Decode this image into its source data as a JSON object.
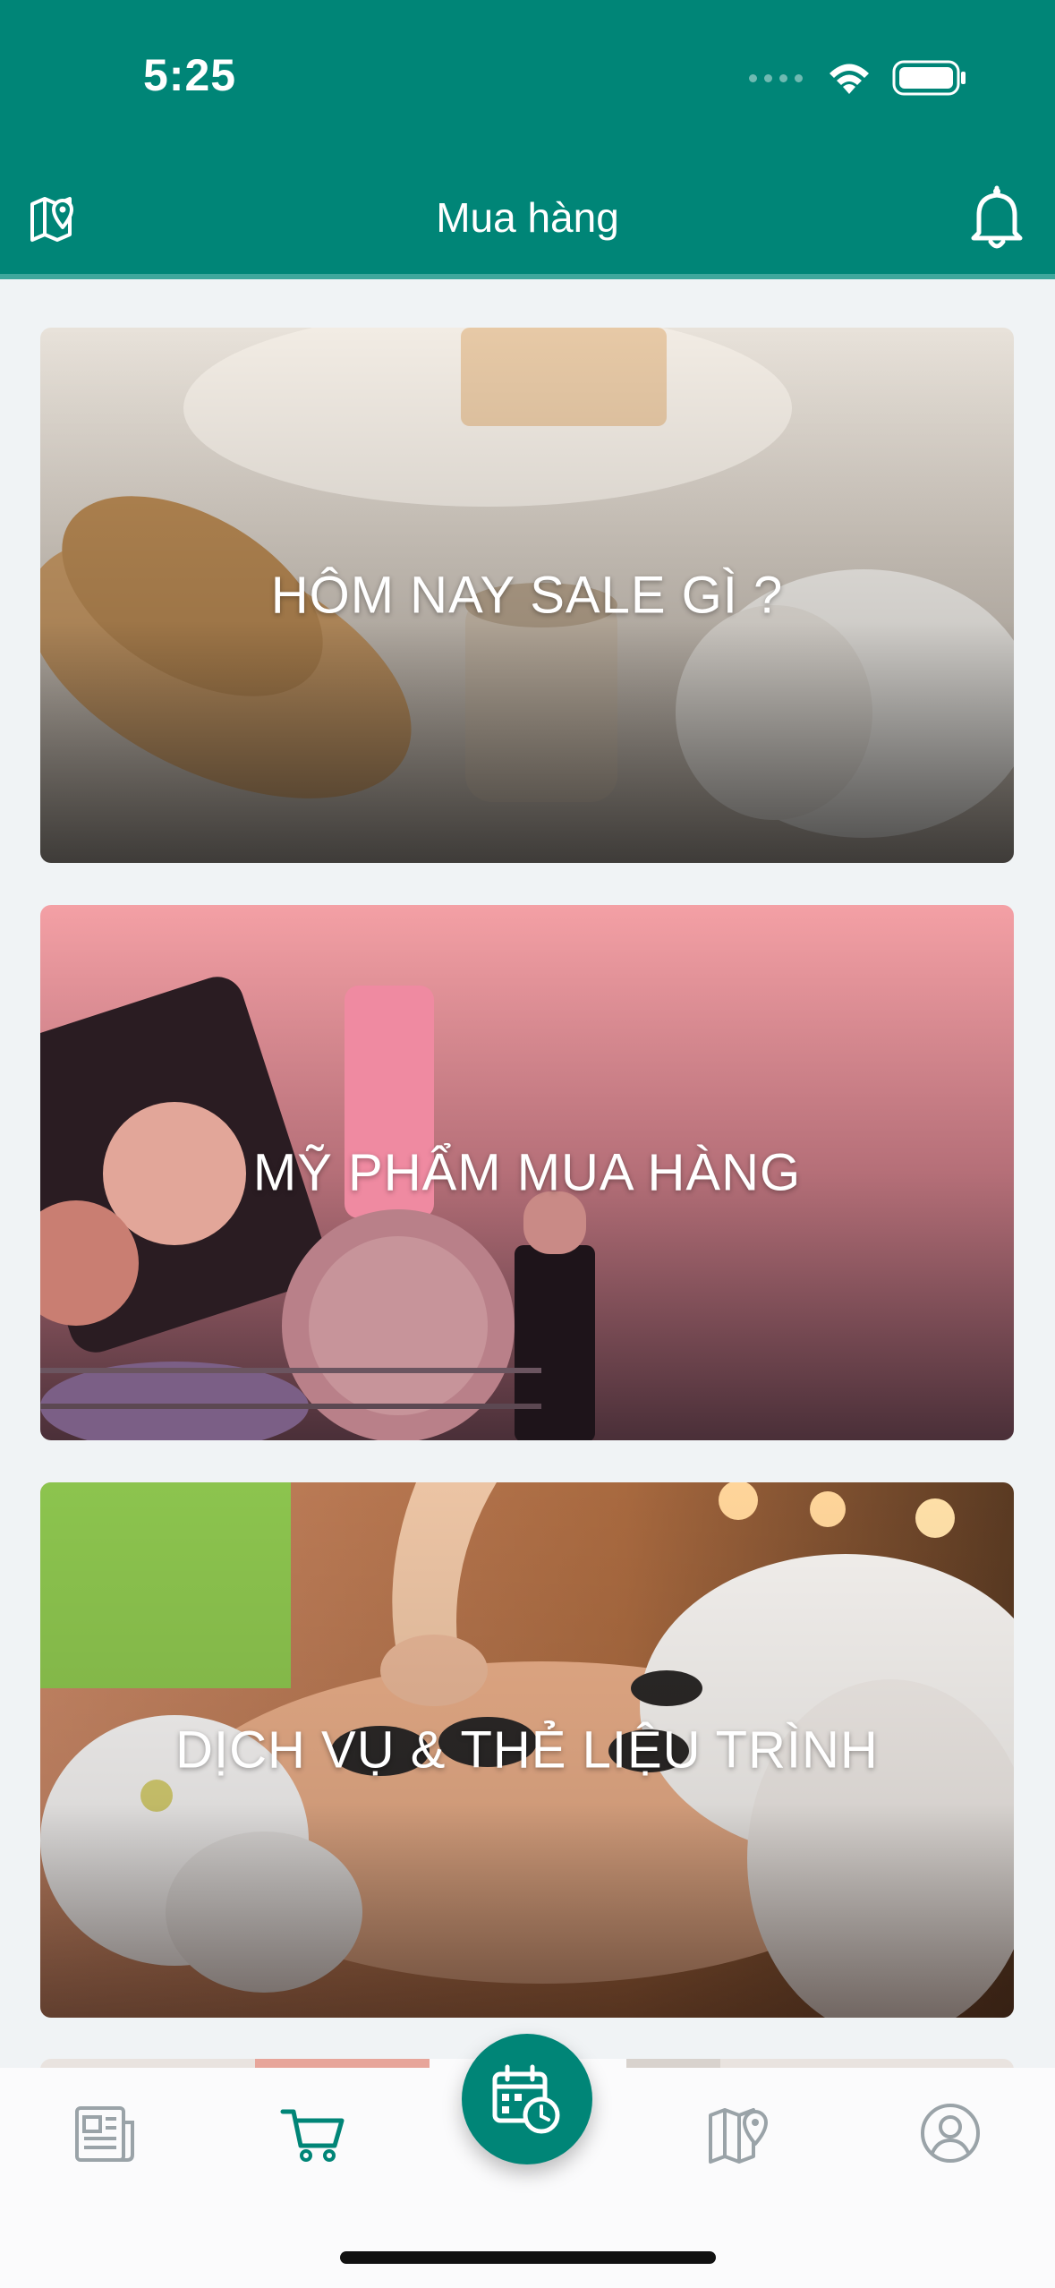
{
  "status_bar": {
    "time": "5:25"
  },
  "header": {
    "title": "Mua hàng",
    "left_icon": "map-pin-icon",
    "right_icon": "bell-icon"
  },
  "cards": [
    {
      "title": "HÔM NAY SALE GÌ ?"
    },
    {
      "title": "MỸ PHẨM MUA HÀNG"
    },
    {
      "title": "DỊCH VỤ & THẺ LIỆU TRÌNH"
    }
  ],
  "bottom_nav": {
    "items": [
      {
        "icon": "newspaper-icon",
        "active": false
      },
      {
        "icon": "cart-icon",
        "active": true
      },
      {
        "icon": "calendar-clock-icon",
        "active": false
      },
      {
        "icon": "map-icon",
        "active": false
      },
      {
        "icon": "account-icon",
        "active": false
      }
    ]
  },
  "colors": {
    "primary": "#008577",
    "background": "#f0f3f5",
    "inactive_icon": "#9aa3a8"
  }
}
